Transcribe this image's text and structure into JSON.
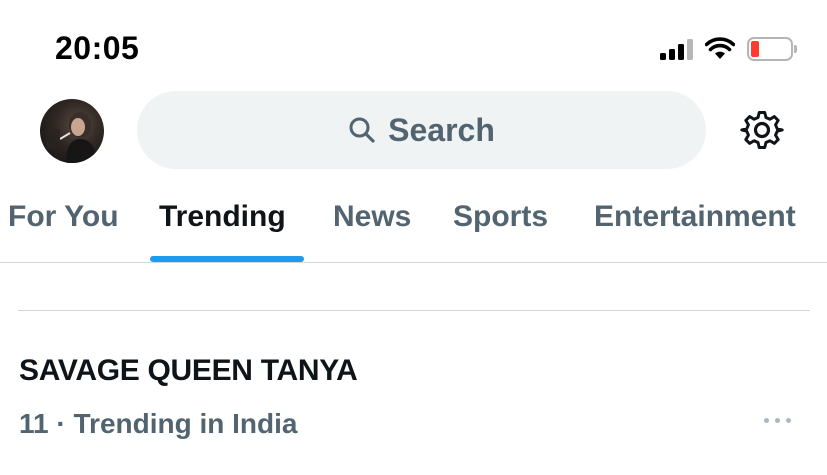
{
  "status_bar": {
    "time": "20:05",
    "icons": [
      "signal-icon",
      "wifi-icon",
      "battery-icon"
    ],
    "battery_level": 0.12,
    "battery_color": "#ff3b30"
  },
  "header": {
    "avatar_icon": "profile-avatar",
    "search": {
      "label": "Search",
      "icon": "search-icon"
    },
    "settings_icon": "gear-icon"
  },
  "tabs": [
    {
      "label": "For You",
      "active": false
    },
    {
      "label": "Trending",
      "active": true
    },
    {
      "label": "News",
      "active": false
    },
    {
      "label": "Sports",
      "active": false
    },
    {
      "label": "Entertainment",
      "active": false
    }
  ],
  "trend": {
    "title": "SAVAGE QUEEN TANYA",
    "meta": "11 · Trending in India",
    "more_icon": "more-icon"
  },
  "colors": {
    "accent": "#1d9bf0",
    "secondary_text": "#536471",
    "search_bg": "#eff3f4",
    "divider": "#cfd9de"
  }
}
